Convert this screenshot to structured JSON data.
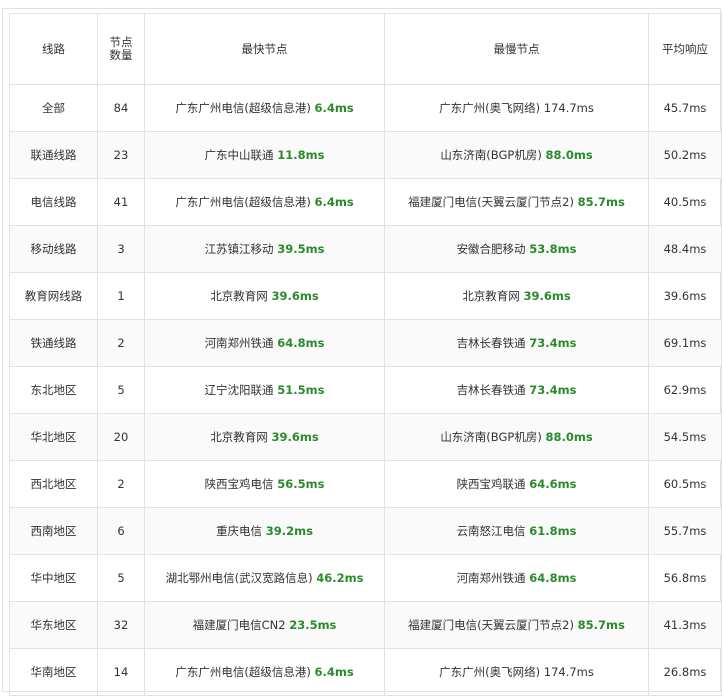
{
  "table": {
    "headers": {
      "route": "线路",
      "node_count": "节点数量",
      "fastest": "最快节点",
      "slowest": "最慢节点",
      "avg": "平均响应"
    },
    "rows": [
      {
        "route": "全部",
        "count": "84",
        "fast_name": "广东广州电信(超级信息港)",
        "fast_ms": "6.4ms",
        "fast_style": "green",
        "slow_name": "广东广州(奥飞网络)",
        "slow_ms": "174.7ms",
        "slow_style": "plain",
        "avg": "45.7ms"
      },
      {
        "route": "联通线路",
        "count": "23",
        "fast_name": "广东中山联通",
        "fast_ms": "11.8ms",
        "fast_style": "green",
        "slow_name": "山东济南(BGP机房)",
        "slow_ms": "88.0ms",
        "slow_style": "green",
        "avg": "50.2ms"
      },
      {
        "route": "电信线路",
        "count": "41",
        "fast_name": "广东广州电信(超级信息港)",
        "fast_ms": "6.4ms",
        "fast_style": "green",
        "slow_name": "福建厦门电信(天翼云厦门节点2)",
        "slow_ms": "85.7ms",
        "slow_style": "green",
        "avg": "40.5ms"
      },
      {
        "route": "移动线路",
        "count": "3",
        "fast_name": "江苏镇江移动",
        "fast_ms": "39.5ms",
        "fast_style": "green",
        "slow_name": "安徽合肥移动",
        "slow_ms": "53.8ms",
        "slow_style": "green",
        "avg": "48.4ms"
      },
      {
        "route": "教育网线路",
        "count": "1",
        "fast_name": "北京教育网",
        "fast_ms": "39.6ms",
        "fast_style": "green",
        "slow_name": "北京教育网",
        "slow_ms": "39.6ms",
        "slow_style": "green",
        "avg": "39.6ms"
      },
      {
        "route": "铁通线路",
        "count": "2",
        "fast_name": "河南郑州铁通",
        "fast_ms": "64.8ms",
        "fast_style": "green",
        "slow_name": "吉林长春铁通",
        "slow_ms": "73.4ms",
        "slow_style": "green",
        "avg": "69.1ms"
      },
      {
        "route": "东北地区",
        "count": "5",
        "fast_name": "辽宁沈阳联通",
        "fast_ms": "51.5ms",
        "fast_style": "green",
        "slow_name": "吉林长春铁通",
        "slow_ms": "73.4ms",
        "slow_style": "green",
        "avg": "62.9ms"
      },
      {
        "route": "华北地区",
        "count": "20",
        "fast_name": "北京教育网",
        "fast_ms": "39.6ms",
        "fast_style": "green",
        "slow_name": "山东济南(BGP机房)",
        "slow_ms": "88.0ms",
        "slow_style": "green",
        "avg": "54.5ms"
      },
      {
        "route": "西北地区",
        "count": "2",
        "fast_name": "陕西宝鸡电信",
        "fast_ms": "56.5ms",
        "fast_style": "green",
        "slow_name": "陕西宝鸡联通",
        "slow_ms": "64.6ms",
        "slow_style": "green",
        "avg": "60.5ms"
      },
      {
        "route": "西南地区",
        "count": "6",
        "fast_name": "重庆电信",
        "fast_ms": "39.2ms",
        "fast_style": "green",
        "slow_name": "云南怒江电信",
        "slow_ms": "61.8ms",
        "slow_style": "green",
        "avg": "55.7ms"
      },
      {
        "route": "华中地区",
        "count": "5",
        "fast_name": "湖北鄂州电信(武汉宽路信息)",
        "fast_ms": "46.2ms",
        "fast_style": "green",
        "slow_name": "河南郑州铁通",
        "slow_ms": "64.8ms",
        "slow_style": "green",
        "avg": "56.8ms"
      },
      {
        "route": "华东地区",
        "count": "32",
        "fast_name": "福建厦门电信CN2",
        "fast_ms": "23.5ms",
        "fast_style": "green",
        "slow_name": "福建厦门电信(天翼云厦门节点2)",
        "slow_ms": "85.7ms",
        "slow_style": "green",
        "avg": "41.3ms"
      },
      {
        "route": "华南地区",
        "count": "14",
        "fast_name": "广东广州电信(超级信息港)",
        "fast_ms": "6.4ms",
        "fast_style": "green",
        "slow_name": "广东广州(奥飞网络)",
        "slow_ms": "174.7ms",
        "slow_style": "plain",
        "avg": "26.8ms"
      }
    ]
  },
  "colors": {
    "fast_value": "#2b8a2b",
    "border": "#e2e2e2",
    "text": "#333333"
  }
}
